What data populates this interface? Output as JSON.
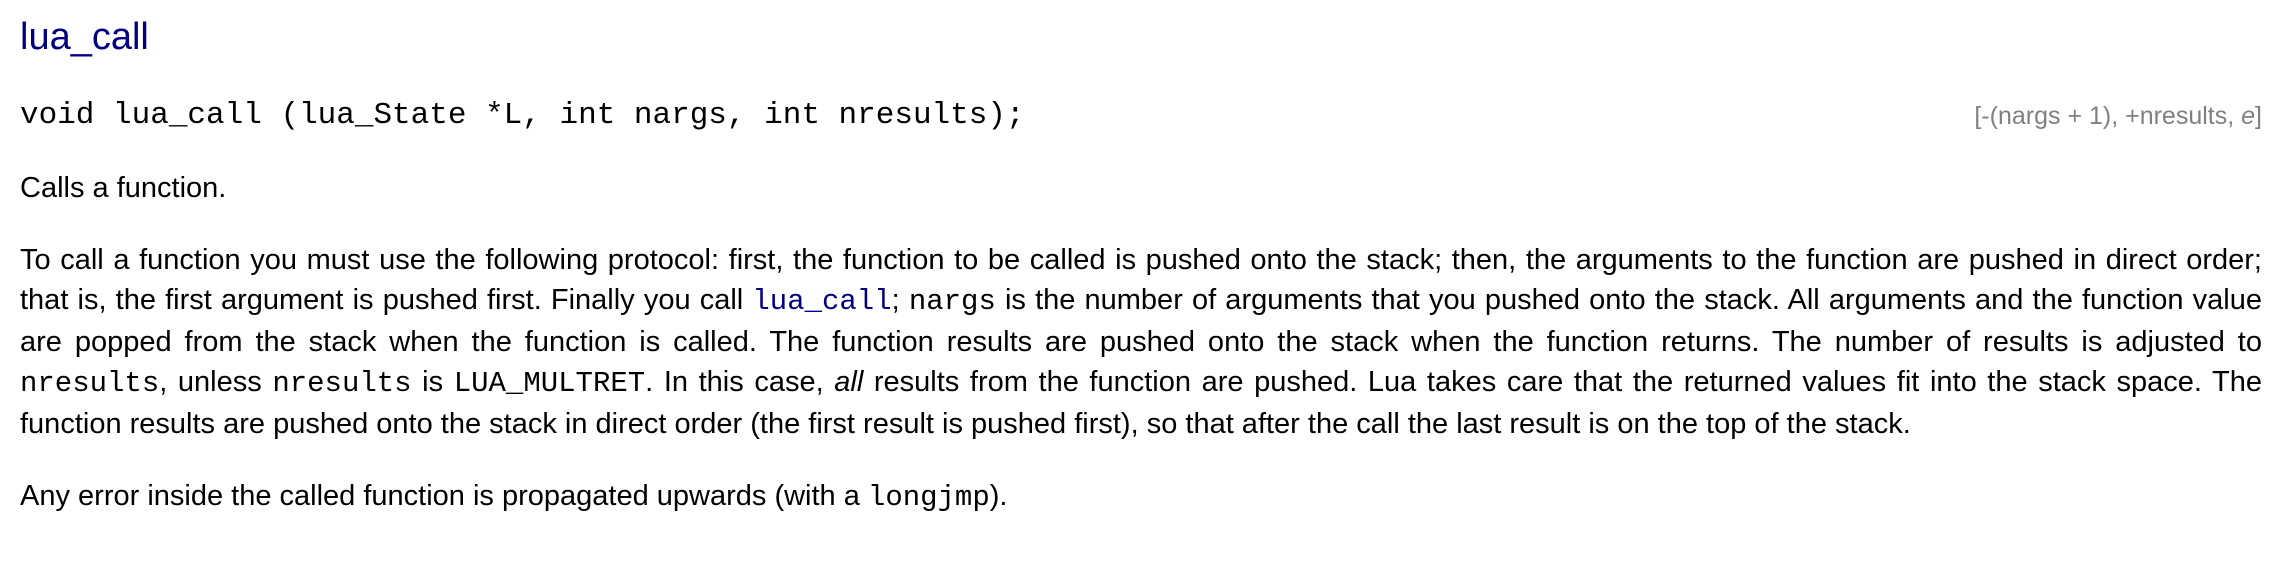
{
  "manual": {
    "title": "lua_call",
    "signature": "void lua_call (lua_State *L, int nargs, int nresults);",
    "stack_indicator": {
      "prefix": "[-(nargs + 1), +nresults, ",
      "errflag": "e",
      "suffix": "]"
    },
    "summary": "Calls a function.",
    "protocol": {
      "t1": "To call a function you must use the following protocol: first, the function to be called is pushed onto the stack; then, the arguments to the function are pushed in direct order; that is, the first argument is pushed first. Finally you call ",
      "c1": "lua_call",
      "t2": "; ",
      "c2": "nargs",
      "t3": " is the number of arguments that you pushed onto the stack. All arguments and the function value are popped from the stack when the function is called. The function results are pushed onto the stack when the function returns. The number of results is adjusted to ",
      "c3": "nresults",
      "t4": ", unless ",
      "c4": "nresults",
      "t5": " is ",
      "c5": "LUA_MULTRET",
      "t6": ". In this case, ",
      "em1": "all",
      "t7": " results from the function are pushed. Lua takes care that the returned values fit into the stack space. The function results are pushed onto the stack in direct order (the first result is pushed first), so that after the call the last result is on the top of the stack."
    },
    "error": {
      "t1": "Any error inside the called function is propagated upwards (with a ",
      "c1": "longjmp",
      "t2": ")."
    }
  }
}
